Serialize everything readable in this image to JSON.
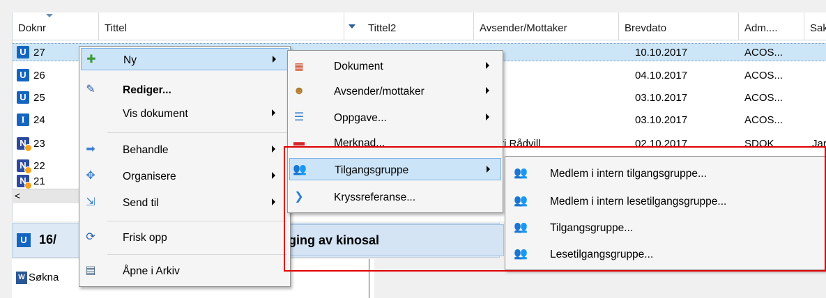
{
  "grid": {
    "headers": [
      "Doknr",
      "Tittel",
      "Tittel2",
      "Avsender/Mottaker",
      "Brevdato",
      "Adm....",
      "Sak"
    ],
    "rows": [
      {
        "badge": "U",
        "doknr": "27",
        "brevdato": "10.10.2017",
        "adm": "ACOS...",
        "sak": ""
      },
      {
        "badge": "U",
        "doknr": "26",
        "brevdato": "04.10.2017",
        "adm": "ACOS...",
        "sak": ""
      },
      {
        "badge": "U",
        "doknr": "25",
        "brevdato": "03.10.2017",
        "adm": "ACOS...",
        "sak": ""
      },
      {
        "badge": "I",
        "doknr": "24",
        "brevdato": "03.10.2017",
        "adm": "ACOS...",
        "sak": ""
      },
      {
        "badge": "N",
        "doknr": "23",
        "avsender": "ri Rådvill",
        "brevdato": "02.10.2017",
        "adm": "SDOK",
        "sak": "Jar"
      },
      {
        "badge": "N",
        "doknr": "22"
      },
      {
        "badge": "N",
        "doknr": "21"
      }
    ],
    "scroll_left_symbol": "<"
  },
  "panel": {
    "badge": "U",
    "number": "16/",
    "title": "ging av kinosal"
  },
  "doclist": {
    "item": "Søkna"
  },
  "menu1": {
    "items": [
      {
        "label": "Ny",
        "icon": "plus-icon",
        "submenu": true,
        "bold": false
      },
      {
        "label": "Rediger...",
        "icon": "pencil-icon",
        "submenu": false,
        "bold": true
      },
      {
        "label": "Vis dokument",
        "icon": "",
        "submenu": true,
        "bold": false
      },
      {
        "label": "Behandle",
        "icon": "arrow-right-icon",
        "submenu": true,
        "bold": false
      },
      {
        "label": "Organisere",
        "icon": "move-icon",
        "submenu": true,
        "bold": false
      },
      {
        "label": "Send til",
        "icon": "send-icon",
        "submenu": true,
        "bold": false
      },
      {
        "label": "Frisk opp",
        "icon": "refresh-icon",
        "submenu": false,
        "bold": false
      },
      {
        "label": "Åpne i Arkiv",
        "icon": "archive-icon",
        "submenu": false,
        "bold": false
      }
    ]
  },
  "menu2": {
    "items": [
      {
        "label": "Dokument",
        "icon": "document-icon",
        "submenu": true
      },
      {
        "label": "Avsender/mottaker",
        "icon": "users-icon",
        "submenu": true
      },
      {
        "label": "Oppgave...",
        "icon": "task-icon",
        "submenu": true
      },
      {
        "label": "Merknad...",
        "icon": "note-icon",
        "submenu": false
      },
      {
        "label": "Tilgangsgruppe",
        "icon": "group-icon",
        "submenu": true
      },
      {
        "label": "Kryssreferanse...",
        "icon": "chevron-right-icon",
        "submenu": false
      }
    ]
  },
  "menu3": {
    "items": [
      {
        "label": "Medlem i intern tilgangsgruppe...",
        "icon": "group-icon"
      },
      {
        "label": "Medlem i intern lesetilgangsgruppe...",
        "icon": "group-icon"
      },
      {
        "label": "Tilgangsgruppe...",
        "icon": "group-icon"
      },
      {
        "label": "Lesetilgangsgruppe...",
        "icon": "group-icon"
      }
    ]
  },
  "colors": {
    "highlight": "#cce4f7",
    "highlight_border": "#7eb4ea",
    "annotation": "#e10000",
    "badge_blue": "#1565c0"
  }
}
